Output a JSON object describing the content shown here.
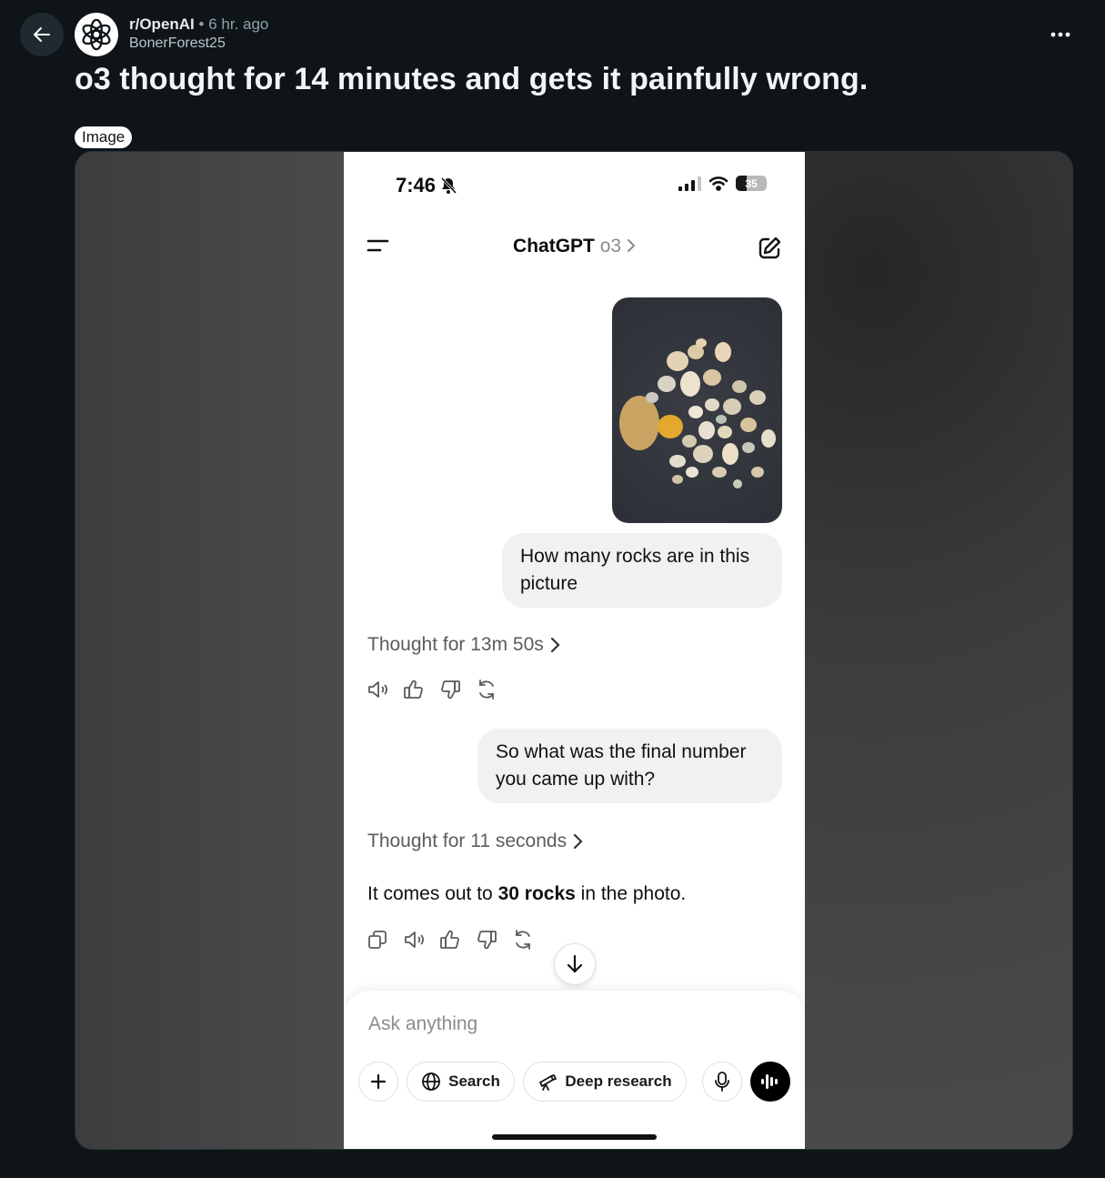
{
  "post": {
    "subreddit": "r/OpenAI",
    "separator": "•",
    "time_ago": "6 hr. ago",
    "author": "BonerForest25",
    "title": "o3 thought for 14 minutes and gets it painfully wrong.",
    "flair": "Image"
  },
  "phone": {
    "status_time": "7:46",
    "battery_level": "35",
    "battery_fraction": 0.35,
    "header": {
      "app_name": "ChatGPT",
      "model": "o3"
    },
    "messages": {
      "user_question": "How many rocks are in this picture",
      "thought_1": "Thought for 13m 50s",
      "user_followup": "So what was the final number you came up with?",
      "thought_2": "Thought for 11 seconds",
      "answer_prefix": "It comes out to",
      "answer_bold": "30 rocks",
      "answer_suffix": "in the photo."
    },
    "composer": {
      "placeholder": "Ask anything",
      "search_label": "Search",
      "deep_research_label": "Deep research"
    }
  },
  "colors": {
    "page_bg": "#0e1417",
    "muted_text": "#8ba2ad",
    "flair_bg": "#ffffff",
    "bubble_bg": "#f1f1f1"
  },
  "icons": [
    "back-arrow-icon",
    "openai-logo-icon",
    "more-icon",
    "bell-muted-icon",
    "signal-icon",
    "wifi-icon",
    "battery-icon",
    "menu-icon",
    "chevron-right-icon",
    "compose-icon",
    "speaker-icon",
    "thumbs-up-icon",
    "thumbs-down-icon",
    "regenerate-icon",
    "copy-icon",
    "arrow-down-icon",
    "plus-icon",
    "globe-icon",
    "telescope-icon",
    "mic-icon",
    "voice-waveform-icon"
  ]
}
